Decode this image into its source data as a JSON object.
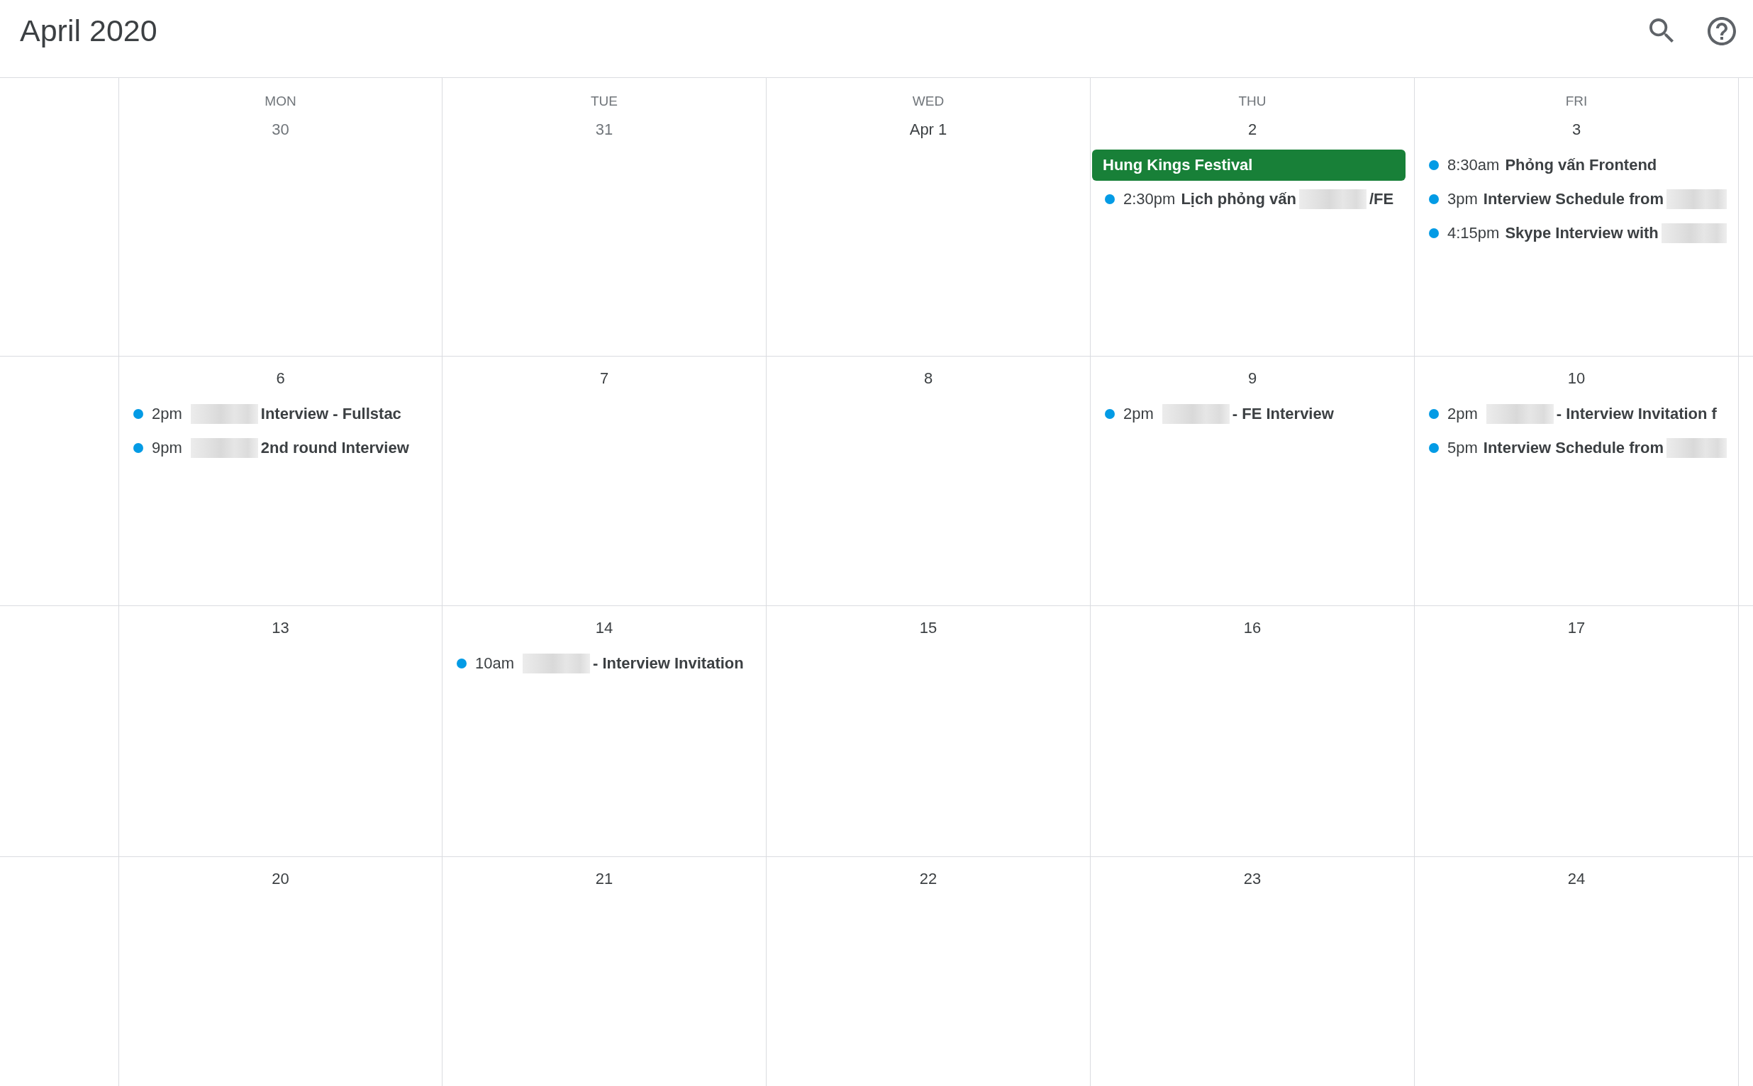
{
  "header": {
    "title": "April 2020"
  },
  "weekdays": [
    "MON",
    "TUE",
    "WED",
    "THU",
    "FRI"
  ],
  "weeks": [
    {
      "days": [
        {
          "date": "30",
          "in_month": false
        },
        {
          "date": "31",
          "in_month": false
        },
        {
          "date": "Apr 1",
          "in_month": true
        },
        {
          "date": "2",
          "in_month": true,
          "events": [
            {
              "kind": "allday",
              "color": "#188038",
              "segments": [
                {
                  "kind": "text",
                  "text": "Hung Kings Festival"
                }
              ]
            },
            {
              "kind": "timed",
              "color": "#039be5",
              "time": "2:30pm",
              "segments": [
                {
                  "kind": "text",
                  "text": "Lịch phỏng vấn"
                },
                {
                  "kind": "redacted"
                },
                {
                  "kind": "text",
                  "text": "/FE"
                }
              ]
            }
          ]
        },
        {
          "date": "3",
          "in_month": true,
          "events": [
            {
              "kind": "timed",
              "color": "#039be5",
              "time": "8:30am",
              "segments": [
                {
                  "kind": "text",
                  "text": "Phỏng vấn Frontend"
                }
              ]
            },
            {
              "kind": "timed",
              "color": "#039be5",
              "time": "3pm",
              "segments": [
                {
                  "kind": "text",
                  "text": "Interview Schedule from"
                },
                {
                  "kind": "redacted"
                }
              ]
            },
            {
              "kind": "timed",
              "color": "#039be5",
              "time": "4:15pm",
              "segments": [
                {
                  "kind": "text",
                  "text": "Skype Interview with"
                },
                {
                  "kind": "redacted"
                }
              ]
            }
          ]
        }
      ]
    },
    {
      "days": [
        {
          "date": "6",
          "in_month": true,
          "events": [
            {
              "kind": "timed",
              "color": "#039be5",
              "time": "2pm",
              "segments": [
                {
                  "kind": "redacted"
                },
                {
                  "kind": "text",
                  "text": "Interview - Fullstac"
                }
              ]
            },
            {
              "kind": "timed",
              "color": "#039be5",
              "time": "9pm",
              "segments": [
                {
                  "kind": "redacted"
                },
                {
                  "kind": "text",
                  "text": "2nd round Interview"
                }
              ]
            }
          ]
        },
        {
          "date": "7",
          "in_month": true
        },
        {
          "date": "8",
          "in_month": true
        },
        {
          "date": "9",
          "in_month": true,
          "events": [
            {
              "kind": "timed",
              "color": "#039be5",
              "time": "2pm",
              "segments": [
                {
                  "kind": "redacted"
                },
                {
                  "kind": "text",
                  "text": "- FE Interview"
                }
              ]
            }
          ]
        },
        {
          "date": "10",
          "in_month": true,
          "events": [
            {
              "kind": "timed",
              "color": "#039be5",
              "time": "2pm",
              "segments": [
                {
                  "kind": "redacted"
                },
                {
                  "kind": "text",
                  "text": "- Interview Invitation f"
                }
              ]
            },
            {
              "kind": "timed",
              "color": "#039be5",
              "time": "5pm",
              "segments": [
                {
                  "kind": "text",
                  "text": "Interview Schedule from"
                },
                {
                  "kind": "redacted"
                }
              ]
            }
          ]
        }
      ]
    },
    {
      "days": [
        {
          "date": "13",
          "in_month": true
        },
        {
          "date": "14",
          "in_month": true,
          "events": [
            {
              "kind": "timed",
              "color": "#039be5",
              "time": "10am",
              "segments": [
                {
                  "kind": "redacted"
                },
                {
                  "kind": "text",
                  "text": "- Interview Invitation"
                }
              ]
            }
          ]
        },
        {
          "date": "15",
          "in_month": true
        },
        {
          "date": "16",
          "in_month": true
        },
        {
          "date": "17",
          "in_month": true
        }
      ]
    },
    {
      "days": [
        {
          "date": "20",
          "in_month": true
        },
        {
          "date": "21",
          "in_month": true
        },
        {
          "date": "22",
          "in_month": true
        },
        {
          "date": "23",
          "in_month": true
        },
        {
          "date": "24",
          "in_month": true
        }
      ]
    }
  ]
}
